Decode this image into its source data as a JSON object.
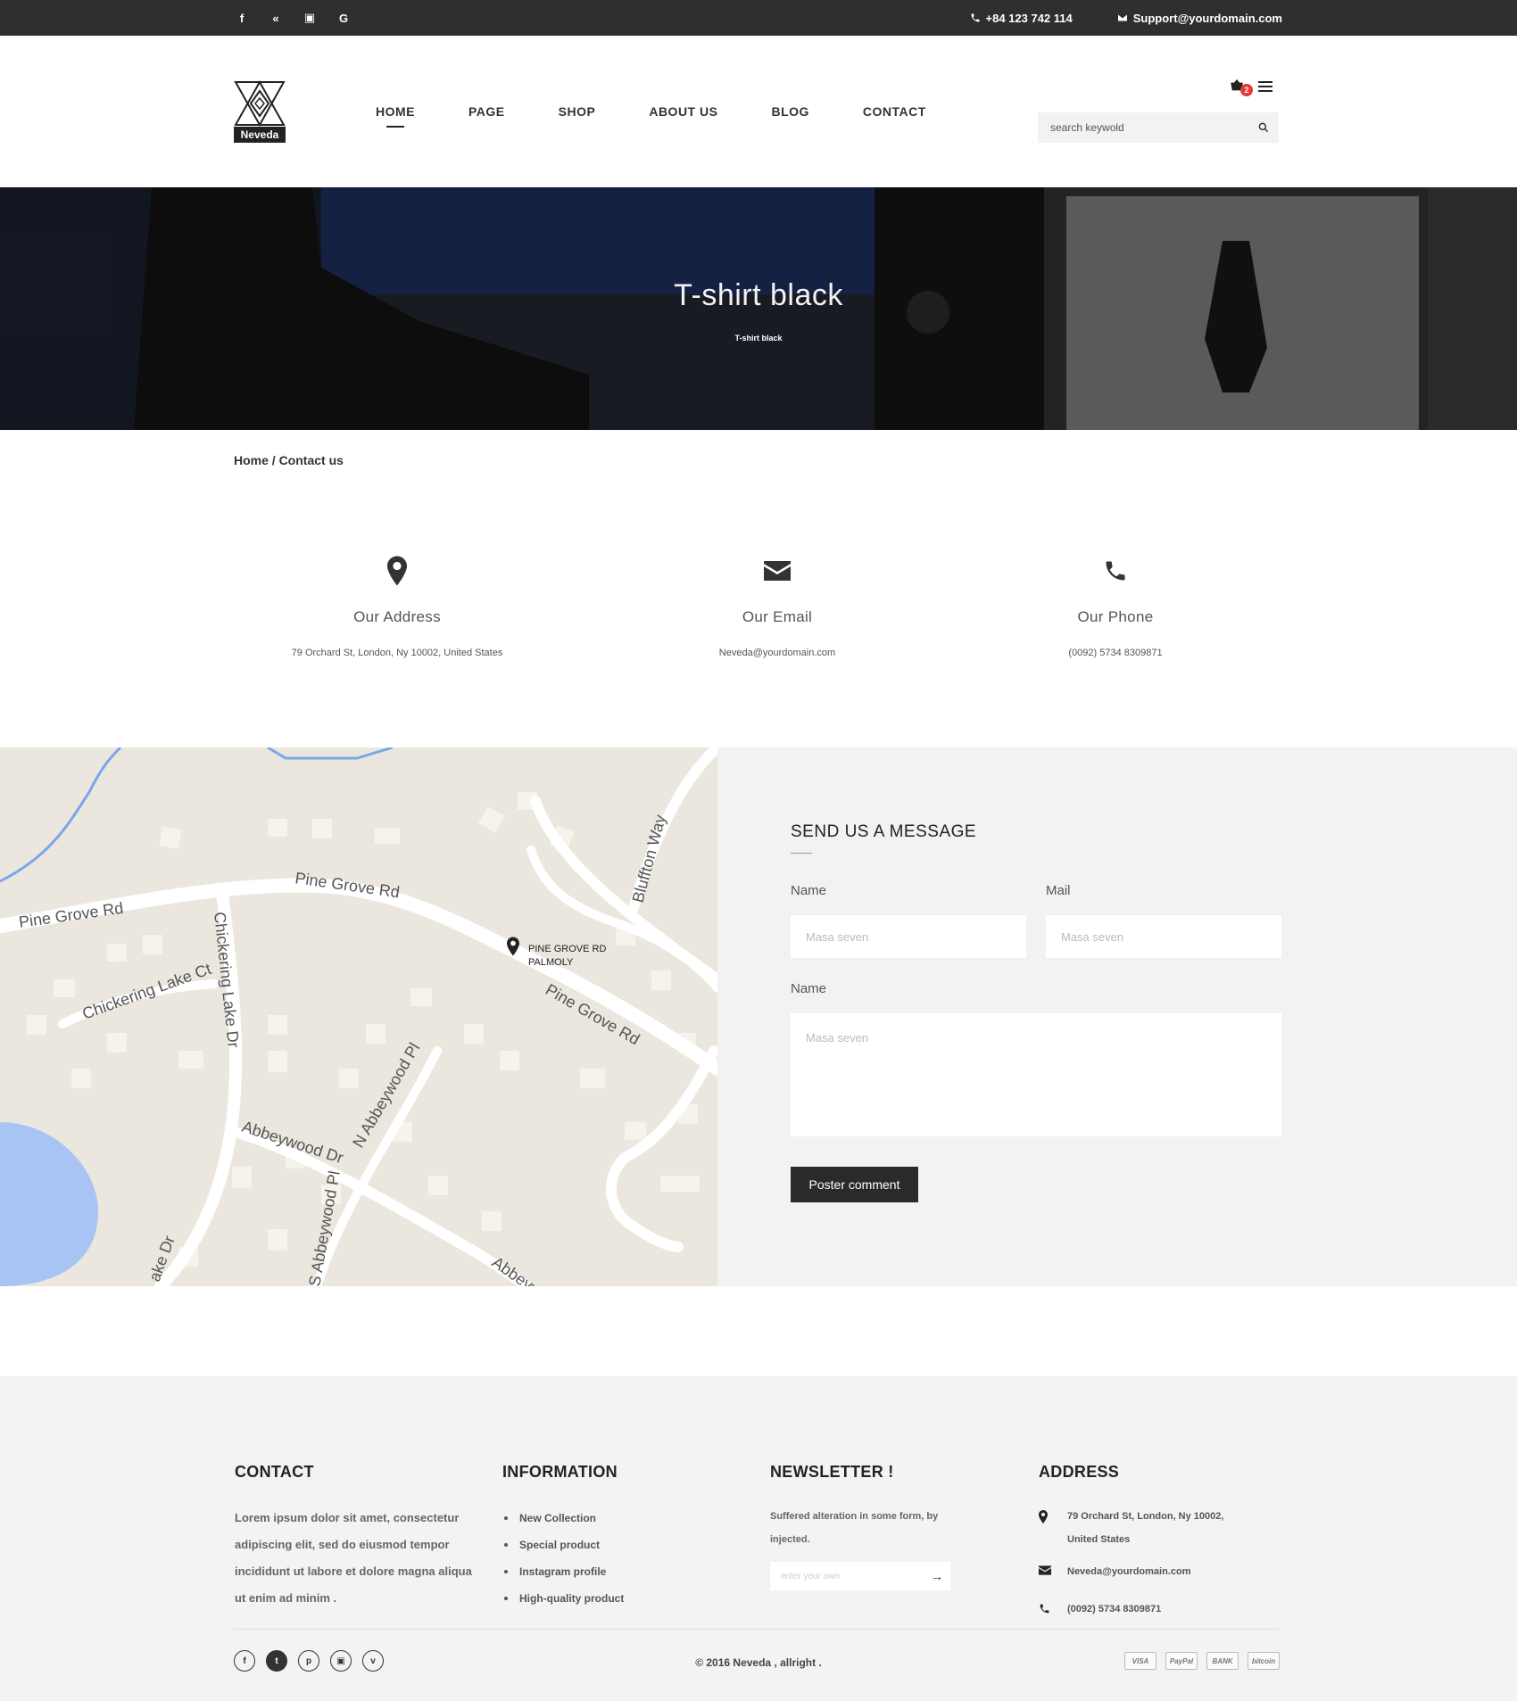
{
  "topbar": {
    "social_icons": [
      "facebook-icon",
      "twitter-icon",
      "instagram-icon",
      "google-icon"
    ],
    "social_glyphs": [
      "f",
      "«",
      "▣",
      "G"
    ],
    "phone": "+84 123 742 114",
    "email": "Support@yourdomain.com"
  },
  "header": {
    "logo_text": "Neveda",
    "nav": [
      "HOME",
      "PAGE",
      "SHOP",
      "ABOUT US",
      "BLOG",
      "CONTACT"
    ],
    "active_nav": "HOME",
    "cart_count": "2",
    "search_placeholder": "search keywold"
  },
  "hero": {
    "title": "T-shirt black",
    "subtitle": "T-shirt black"
  },
  "breadcrumb": "Home / Contact us",
  "info": [
    {
      "icon": "map-marker-icon",
      "title": "Our Address",
      "value": "79 Orchard St, London, Ny 10002, United States"
    },
    {
      "icon": "envelope-icon",
      "title": "Our Email",
      "value": "Neveda@yourdomain.com"
    },
    {
      "icon": "phone-icon",
      "title": "Our Phone",
      "value": "(0092) 5734 8309871"
    }
  ],
  "map": {
    "marker_label_1": "PINE GROVE RD",
    "marker_label_2": "PALMOLY",
    "streets": [
      "Pine Grove Rd",
      "Pine Grove Rd",
      "Pine Grove Rd",
      "Chickering Lake Ct",
      "Chickering Lake Dr",
      "Bluffton Way",
      "N Abbeywood Pl",
      "Abbeywood Dr",
      "S Abbeywood Pl",
      "Abbeyw",
      "ake Dr"
    ]
  },
  "form": {
    "title": "SEND US A MESSAGE",
    "name_label": "Name",
    "mail_label": "Mail",
    "message_label": "Name",
    "name_placeholder": "Masa seven",
    "mail_placeholder": "Masa seven",
    "message_placeholder": "Masa seven",
    "submit_label": "Poster comment"
  },
  "footer": {
    "contact_title": "CONTACT",
    "contact_text": "Lorem ipsum dolor sit amet, consectetur adipiscing elit, sed do eiusmod tempor incididunt ut labore et dolore magna aliqua ut enim ad minim .",
    "information_title": "INFORMATION",
    "information_links": [
      "New Collection",
      "Special product",
      "Instagram profile",
      "High-quality product"
    ],
    "newsletter_title": "NEWSLETTER !",
    "newsletter_text": "Suffered alteration in some form, by injected.",
    "newsletter_placeholder": "enter your own",
    "address_title": "ADDRESS",
    "address": "79 Orchard St, London, Ny 10002, United States",
    "email": "Neveda@yourdomain.com",
    "phone": "(0092) 5734 8309871",
    "copyright": "©  2016 Neveda , allright .",
    "social_icons": [
      "facebook-icon",
      "twitter-icon",
      "pinterest-icon",
      "instagram-icon",
      "vine-icon"
    ],
    "social_glyphs": [
      "f",
      "t",
      "p",
      "▣",
      "v"
    ],
    "payments": [
      "VISA",
      "PayPal",
      "BANK",
      "bitcoin"
    ]
  }
}
